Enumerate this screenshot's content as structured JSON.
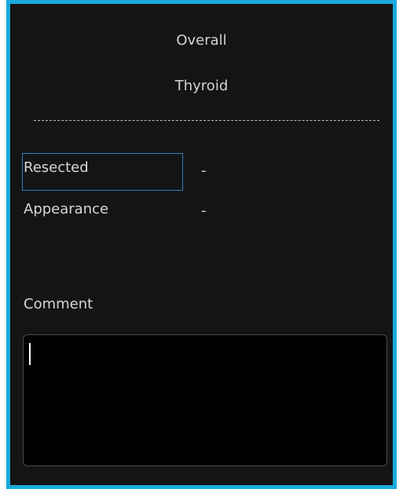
{
  "header": {
    "section_title": "Overall",
    "organ_title": "Thyroid"
  },
  "fields": [
    {
      "label": "Resected",
      "value": "-"
    },
    {
      "label": "Appearance",
      "value": "-"
    }
  ],
  "comment": {
    "label": "Comment",
    "value": ""
  },
  "colors": {
    "frame": "#1aa9dd",
    "focus": "#2f7fc8",
    "background": "#141414"
  }
}
